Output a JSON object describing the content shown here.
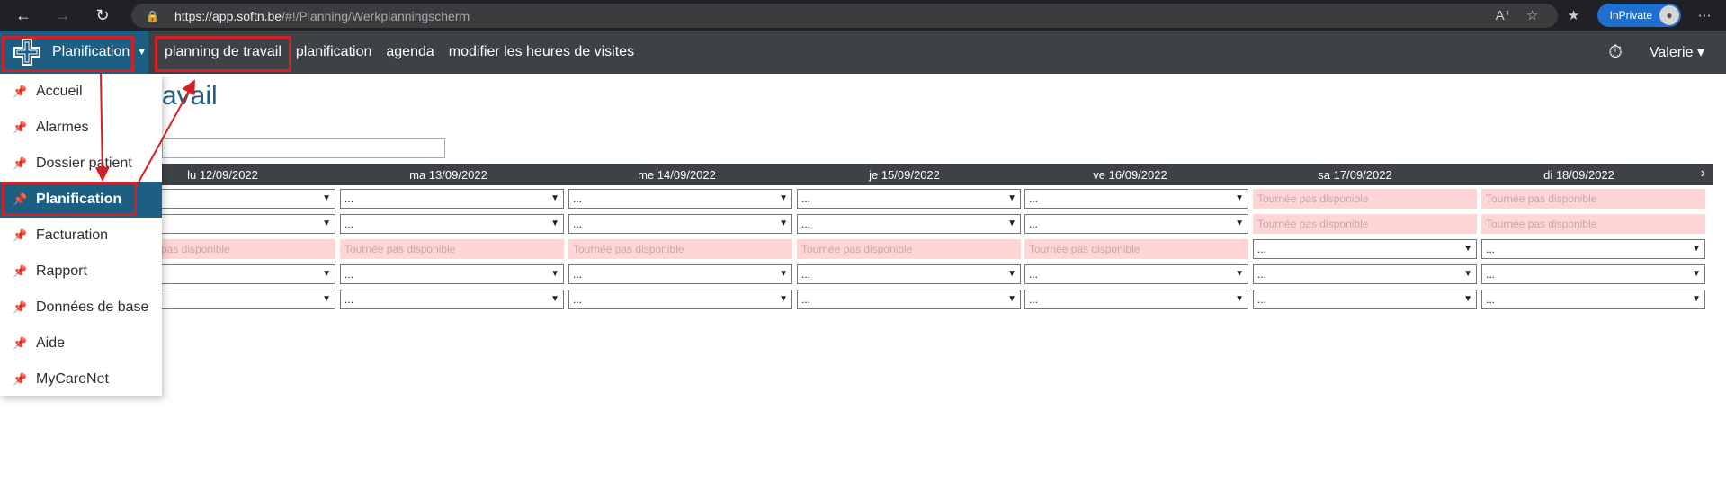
{
  "browser": {
    "url_host": "https://app.softn.be",
    "url_path": "/#!/Planning/Werkplanningscherm",
    "inprivate_label": "InPrivate"
  },
  "nav": {
    "brand": "Planification",
    "links": [
      "planning de travail",
      "planification",
      "agenda",
      "modifier les heures de visites"
    ],
    "user": "Valerie"
  },
  "page": {
    "title_visible": "ravail"
  },
  "menu": {
    "items": [
      "Accueil",
      "Alarmes",
      "Dossier patient",
      "Planification",
      "Facturation",
      "Rapport",
      "Données de base",
      "Aide",
      "MyCareNet"
    ]
  },
  "schedule": {
    "days": [
      "lu 12/09/2022",
      "ma 13/09/2022",
      "me 14/09/2022",
      "je 15/09/2022",
      "ve 16/09/2022",
      "sa 17/09/2022",
      "di 18/09/2022"
    ],
    "not_available": "Tournée pas disponible",
    "placeholder": "...",
    "first_cell_partial": "a",
    "partial_na": "pas disponible"
  }
}
